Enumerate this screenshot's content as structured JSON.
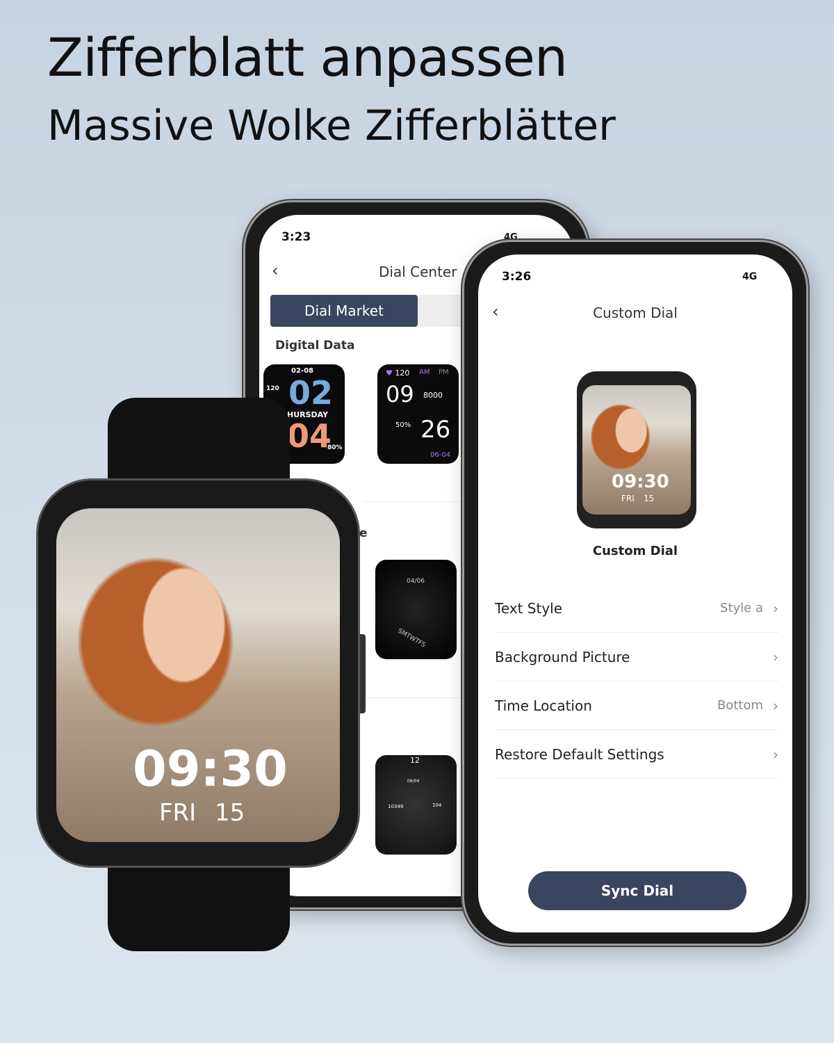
{
  "headline": {
    "title": "Zifferblatt anpassen",
    "subtitle": "Massive Wolke Zifferblätter"
  },
  "back_phone": {
    "time": "3:23",
    "signal": "4G",
    "header": "Dial Center",
    "tab_active": "Dial Market",
    "section": "Digital Data",
    "partial_section": "e",
    "faces": [
      {
        "date": "02-08",
        "hour": "02",
        "day": "HURSDAY",
        "min": "04",
        "hr": "120",
        "battery": "80%"
      },
      {
        "hr": "120",
        "am": "AM",
        "pm": "PM",
        "hour": "09",
        "min": "26",
        "steps": "8000",
        "battery": "50%",
        "date": "06-04"
      },
      {
        "date": "04/06",
        "weekdays": "SMTWTFS"
      },
      {
        "twelve": "12",
        "date": "06/04",
        "steps": "10349",
        "hr": "104"
      }
    ]
  },
  "front_phone": {
    "time": "3:26",
    "signal": "4G",
    "header": "Custom Dial",
    "preview_time": "09:30",
    "preview_day": "FRI",
    "preview_date": "15",
    "preview_label": "Custom Dial",
    "settings": [
      {
        "label": "Text Style",
        "value": "Style a"
      },
      {
        "label": "Background Picture",
        "value": ""
      },
      {
        "label": "Time Location",
        "value": "Bottom"
      },
      {
        "label": "Restore Default Settings",
        "value": ""
      }
    ],
    "sync_button": "Sync Dial",
    "accent": "#3a4560"
  },
  "watch": {
    "time": "09:30",
    "day": "FRI",
    "date": "15"
  }
}
